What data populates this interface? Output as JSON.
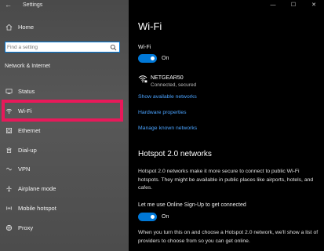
{
  "window": {
    "title": "Settings",
    "controls": [
      "—",
      "☐",
      "✕"
    ]
  },
  "sidebar": {
    "home_label": "Home",
    "search_placeholder": "Find a setting",
    "section_title": "Network & Internet",
    "items": [
      {
        "label": "Status",
        "icon": "status-icon"
      },
      {
        "label": "Wi-Fi",
        "icon": "wifi-icon",
        "selected": true
      },
      {
        "label": "Ethernet",
        "icon": "ethernet-icon"
      },
      {
        "label": "Dial-up",
        "icon": "dialup-icon"
      },
      {
        "label": "VPN",
        "icon": "vpn-icon"
      },
      {
        "label": "Airplane mode",
        "icon": "airplane-icon"
      },
      {
        "label": "Mobile hotspot",
        "icon": "hotspot-icon"
      },
      {
        "label": "Proxy",
        "icon": "proxy-icon"
      }
    ]
  },
  "main": {
    "title": "Wi-Fi",
    "wifi_label": "Wi-Fi",
    "wifi_toggle_text": "On",
    "network_name": "NETGEAR50",
    "network_status": "Connected, secured",
    "links": {
      "show_networks": "Show available networks",
      "hardware": "Hardware properties",
      "manage": "Manage known networks"
    },
    "hotspot_title": "Hotspot 2.0 networks",
    "hotspot_desc": "Hotspot 2.0 networks make it more secure to connect to public Wi-Fi hotspots. They might be available in public places like airports, hotels, and cafes.",
    "signup_label": "Let me use Online Sign-Up to get connected",
    "signup_toggle_text": "On",
    "signup_desc": "When you turn this on and choose a Hotspot 2.0 network, we'll show a list of providers to choose from so you can get online."
  },
  "colors": {
    "accent": "#0078d7",
    "link": "#4aa3ff",
    "highlight": "#e8195a"
  }
}
